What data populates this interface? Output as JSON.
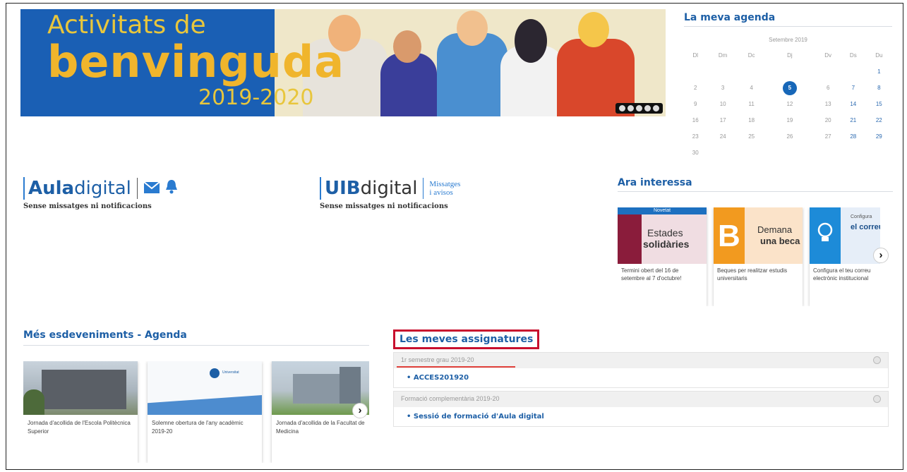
{
  "banner": {
    "line1": "Activitats de",
    "line2": "benvinguda",
    "line3": "2019-2020"
  },
  "agenda": {
    "title": "La meva agenda",
    "month_label": "Setembre 2019",
    "weekdays": [
      "Dl",
      "Dm",
      "Dc",
      "Dj",
      "Dv",
      "Ds",
      "Du"
    ],
    "weeks": [
      [
        "",
        "",
        "",
        "",
        "",
        "",
        "1"
      ],
      [
        "2",
        "3",
        "4",
        "5",
        "6",
        "7",
        "8"
      ],
      [
        "9",
        "10",
        "11",
        "12",
        "13",
        "14",
        "15"
      ],
      [
        "16",
        "17",
        "18",
        "19",
        "20",
        "21",
        "22"
      ],
      [
        "23",
        "24",
        "25",
        "26",
        "27",
        "28",
        "29"
      ],
      [
        "30",
        "",
        "",
        "",
        "",
        "",
        ""
      ]
    ],
    "today": "5"
  },
  "aula": {
    "brand_bold": "Aula",
    "brand_light": "digital",
    "note": "Sense missatges ni notificacions"
  },
  "uib": {
    "brand_bold": "UIB",
    "brand_light": "digital",
    "msg_line1": "Missatges",
    "msg_line2": "i avisos",
    "note": "Sense missatges ni notificacions"
  },
  "interessa": {
    "title": "Ara interessa",
    "cards": [
      {
        "tag": "Novetat",
        "img_line1": "Estades",
        "img_line2": "solidàries",
        "text": "Termini obert del 16 de setembre al 7 d'octubre!"
      },
      {
        "img_line1": "Demana",
        "img_line2": "una beca",
        "text": "Beques per realitzar estudis universitaris"
      },
      {
        "img_line1": "Configura",
        "img_line2": "el correu",
        "text": "Configura el teu correu electrònic institucional"
      }
    ]
  },
  "esdeveniments": {
    "title": "Més esdeveniments - Agenda",
    "cards": [
      {
        "text": "Jornada d'acollida de l'Escola Politècnica Superior"
      },
      {
        "text": "Solemne obertura de l'any acadèmic 2019-20",
        "logo": "Universitat"
      },
      {
        "text": "Jornada d'acollida de la Facultat de Medicina"
      }
    ]
  },
  "assignatures": {
    "title": "Les meves assignatures",
    "groups": [
      {
        "label": "1r semestre grau 2019-20",
        "items": [
          "ACCES201920"
        ]
      },
      {
        "label": "Formació complementària 2019-20",
        "items": [
          "Sessió de formació d'Aula digital"
        ]
      }
    ]
  },
  "colors": {
    "brand_blue": "#1d5fa6",
    "highlight_red": "#c8102e",
    "banner_blue": "#1a5fb4",
    "banner_yellow": "#f0b52c"
  }
}
